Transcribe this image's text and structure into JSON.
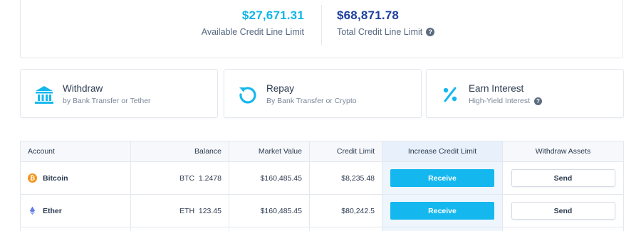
{
  "summary": {
    "available": {
      "value": "$27,671.31",
      "label": "Available Credit Line Limit"
    },
    "total": {
      "value": "$68,871.78",
      "label": "Total Credit Line Limit",
      "help": "?"
    }
  },
  "actions": [
    {
      "title": "Withdraw",
      "subtitle": "by Bank Transfer or Tether",
      "icon": "bank-icon"
    },
    {
      "title": "Repay",
      "subtitle": "By Bank Transfer or Crypto",
      "icon": "refresh-icon"
    },
    {
      "title": "Earn Interest",
      "subtitle": "High-Yield Interest",
      "icon": "percent-icon",
      "help": "?"
    }
  ],
  "table": {
    "headers": [
      "Account",
      "Balance",
      "Market Value",
      "Credit Limit",
      "Increase Credit Limit",
      "Withdraw Assets"
    ],
    "rows": [
      {
        "account": "Bitcoin",
        "icon": "bitcoin-icon",
        "balance_symbol": "BTC",
        "balance_amount": "1.2478",
        "market_value": "$160,485.45",
        "credit_limit": "$8,235.48",
        "receive_label": "Receive",
        "send_label": "Send"
      },
      {
        "account": "Ether",
        "icon": "ether-icon",
        "balance_symbol": "ETH",
        "balance_amount": "123.45",
        "market_value": "$160,485.45",
        "credit_limit": "$80,242.5",
        "receive_label": "Receive",
        "send_label": "Send"
      }
    ]
  },
  "colors": {
    "accent": "#15b8ee",
    "available_value": "#0fb6e8",
    "total_value": "#1d3f9e",
    "bitcoin": "#f7931a",
    "ether": "#627eea"
  }
}
